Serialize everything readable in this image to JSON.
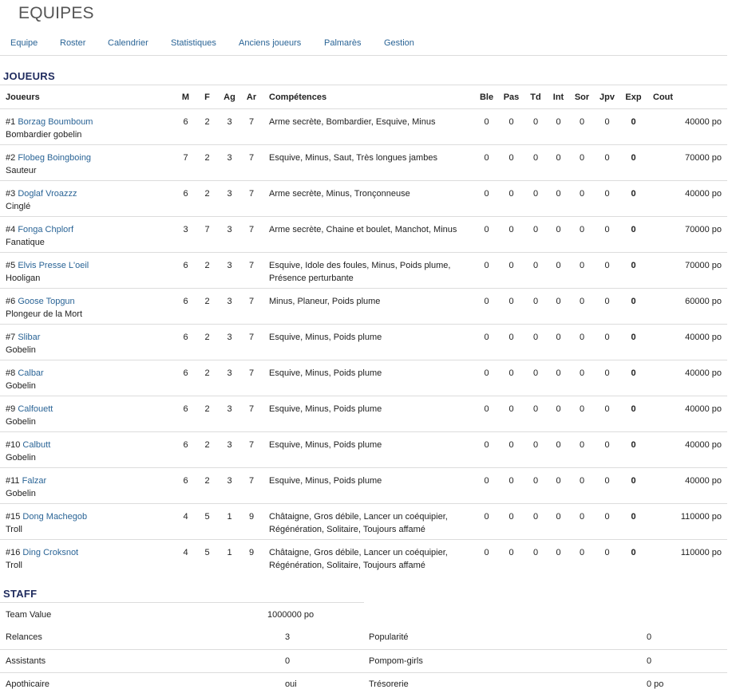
{
  "header": {
    "title": "EQUIPES"
  },
  "nav": [
    {
      "label": "Equipe"
    },
    {
      "label": "Roster"
    },
    {
      "label": "Calendrier"
    },
    {
      "label": "Statistiques"
    },
    {
      "label": "Anciens joueurs"
    },
    {
      "label": "Palmarès"
    },
    {
      "label": "Gestion"
    }
  ],
  "players_section": {
    "title": "JOUEURS",
    "columns": [
      "Joueurs",
      "M",
      "F",
      "Ag",
      "Ar",
      "Compétences",
      "Ble",
      "Pas",
      "Td",
      "Int",
      "Sor",
      "Jpv",
      "Exp",
      "Cout"
    ],
    "rows": [
      {
        "num": "#1",
        "name": "Borzag Boumboum",
        "position": "Bombardier gobelin",
        "m": "6",
        "f": "2",
        "ag": "3",
        "ar": "7",
        "skills": "Arme secrète, Bombardier, Esquive, Minus",
        "ble": "0",
        "pas": "0",
        "td": "0",
        "int": "0",
        "sor": "0",
        "jpv": "0",
        "exp": "0",
        "cout": "40000 po"
      },
      {
        "num": "#2",
        "name": "Flobeg Boingboing",
        "position": "Sauteur",
        "m": "7",
        "f": "2",
        "ag": "3",
        "ar": "7",
        "skills": "Esquive, Minus, Saut, Très longues jambes",
        "ble": "0",
        "pas": "0",
        "td": "0",
        "int": "0",
        "sor": "0",
        "jpv": "0",
        "exp": "0",
        "cout": "70000 po"
      },
      {
        "num": "#3",
        "name": "Doglaf Vroazzz",
        "position": "Cinglé",
        "m": "6",
        "f": "2",
        "ag": "3",
        "ar": "7",
        "skills": "Arme secrète, Minus, Tronçonneuse",
        "ble": "0",
        "pas": "0",
        "td": "0",
        "int": "0",
        "sor": "0",
        "jpv": "0",
        "exp": "0",
        "cout": "40000 po"
      },
      {
        "num": "#4",
        "name": "Fonga Chplorf",
        "position": "Fanatique",
        "m": "3",
        "f": "7",
        "ag": "3",
        "ar": "7",
        "skills": "Arme secrète, Chaine et boulet, Manchot, Minus",
        "ble": "0",
        "pas": "0",
        "td": "0",
        "int": "0",
        "sor": "0",
        "jpv": "0",
        "exp": "0",
        "cout": "70000 po"
      },
      {
        "num": "#5",
        "name": "Elvis Presse L'oeil",
        "position": "Hooligan",
        "m": "6",
        "f": "2",
        "ag": "3",
        "ar": "7",
        "skills": "Esquive, Idole des foules, Minus, Poids plume, Présence perturbante",
        "ble": "0",
        "pas": "0",
        "td": "0",
        "int": "0",
        "sor": "0",
        "jpv": "0",
        "exp": "0",
        "cout": "70000 po"
      },
      {
        "num": "#6",
        "name": "Goose Topgun",
        "position": "Plongeur de la Mort",
        "m": "6",
        "f": "2",
        "ag": "3",
        "ar": "7",
        "skills": "Minus, Planeur, Poids plume",
        "ble": "0",
        "pas": "0",
        "td": "0",
        "int": "0",
        "sor": "0",
        "jpv": "0",
        "exp": "0",
        "cout": "60000 po"
      },
      {
        "num": "#7",
        "name": "Slibar",
        "position": "Gobelin",
        "m": "6",
        "f": "2",
        "ag": "3",
        "ar": "7",
        "skills": "Esquive, Minus, Poids plume",
        "ble": "0",
        "pas": "0",
        "td": "0",
        "int": "0",
        "sor": "0",
        "jpv": "0",
        "exp": "0",
        "cout": "40000 po"
      },
      {
        "num": "#8",
        "name": "Calbar",
        "position": "Gobelin",
        "m": "6",
        "f": "2",
        "ag": "3",
        "ar": "7",
        "skills": "Esquive, Minus, Poids plume",
        "ble": "0",
        "pas": "0",
        "td": "0",
        "int": "0",
        "sor": "0",
        "jpv": "0",
        "exp": "0",
        "cout": "40000 po"
      },
      {
        "num": "#9",
        "name": "Calfouett",
        "position": "Gobelin",
        "m": "6",
        "f": "2",
        "ag": "3",
        "ar": "7",
        "skills": "Esquive, Minus, Poids plume",
        "ble": "0",
        "pas": "0",
        "td": "0",
        "int": "0",
        "sor": "0",
        "jpv": "0",
        "exp": "0",
        "cout": "40000 po"
      },
      {
        "num": "#10",
        "name": "Calbutt",
        "position": "Gobelin",
        "m": "6",
        "f": "2",
        "ag": "3",
        "ar": "7",
        "skills": "Esquive, Minus, Poids plume",
        "ble": "0",
        "pas": "0",
        "td": "0",
        "int": "0",
        "sor": "0",
        "jpv": "0",
        "exp": "0",
        "cout": "40000 po"
      },
      {
        "num": "#11",
        "name": "Falzar",
        "position": "Gobelin",
        "m": "6",
        "f": "2",
        "ag": "3",
        "ar": "7",
        "skills": "Esquive, Minus, Poids plume",
        "ble": "0",
        "pas": "0",
        "td": "0",
        "int": "0",
        "sor": "0",
        "jpv": "0",
        "exp": "0",
        "cout": "40000 po"
      },
      {
        "num": "#15",
        "name": "Dong Machegob",
        "position": "Troll",
        "m": "4",
        "f": "5",
        "ag": "1",
        "ar": "9",
        "skills": "Châtaigne, Gros débile, Lancer un coéquipier, Régénération, Solitaire, Toujours affamé",
        "ble": "0",
        "pas": "0",
        "td": "0",
        "int": "0",
        "sor": "0",
        "jpv": "0",
        "exp": "0",
        "cout": "110000 po"
      },
      {
        "num": "#16",
        "name": "Ding Croksnot",
        "position": "Troll",
        "m": "4",
        "f": "5",
        "ag": "1",
        "ar": "9",
        "skills": "Châtaigne, Gros débile, Lancer un coéquipier, Régénération, Solitaire, Toujours affamé",
        "ble": "0",
        "pas": "0",
        "td": "0",
        "int": "0",
        "sor": "0",
        "jpv": "0",
        "exp": "0",
        "cout": "110000 po"
      }
    ]
  },
  "staff_section": {
    "title": "STAFF",
    "team_value_label": "Team Value",
    "team_value": "1000000 po",
    "rows": [
      {
        "left_label": "Relances",
        "left_value": "3",
        "right_label": "Popularité",
        "right_value": "0"
      },
      {
        "left_label": "Assistants",
        "left_value": "0",
        "right_label": "Pompom-girls",
        "right_value": "0"
      },
      {
        "left_label": "Apothicaire",
        "left_value": "oui",
        "right_label": "Trésorerie",
        "right_value": "0 po"
      }
    ]
  },
  "colors": {
    "link": "#2a6496",
    "section_title": "#1f2b5e",
    "border": "#dcdcdc",
    "title": "#555555"
  }
}
